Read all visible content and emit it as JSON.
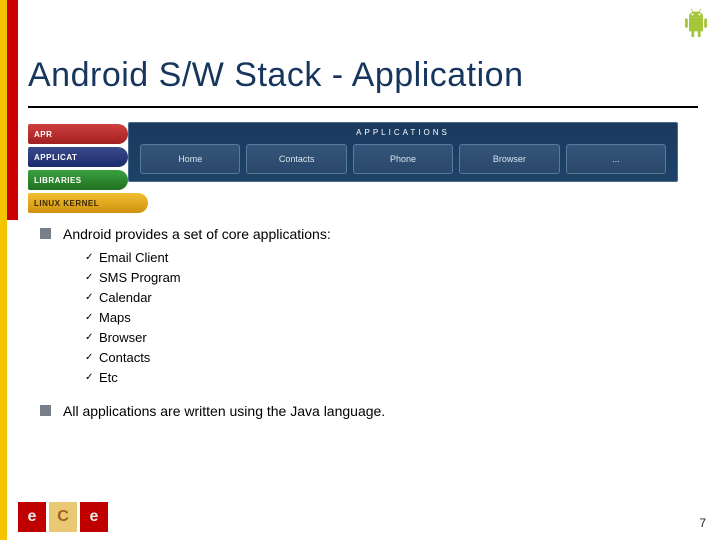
{
  "title": "Android S/W Stack - Application",
  "diagram": {
    "bar_title": "APPLICATIONS",
    "apps": [
      "Home",
      "Contacts",
      "Phone",
      "Browser",
      "..."
    ],
    "tabs": {
      "red": "APR",
      "blue": "APPLICAT",
      "green": "LIBRARIES",
      "yellow": "LINUX KERNEL"
    }
  },
  "intro": "Android provides a set of core applications:",
  "items": [
    "Email Client",
    "SMS Program",
    "Calendar",
    "Maps",
    "Browser",
    "Contacts",
    "Etc"
  ],
  "closing": "All applications are written using the Java language.",
  "page_number": "7",
  "logo": {
    "e1": "e",
    "c": "C",
    "e2": "e"
  }
}
